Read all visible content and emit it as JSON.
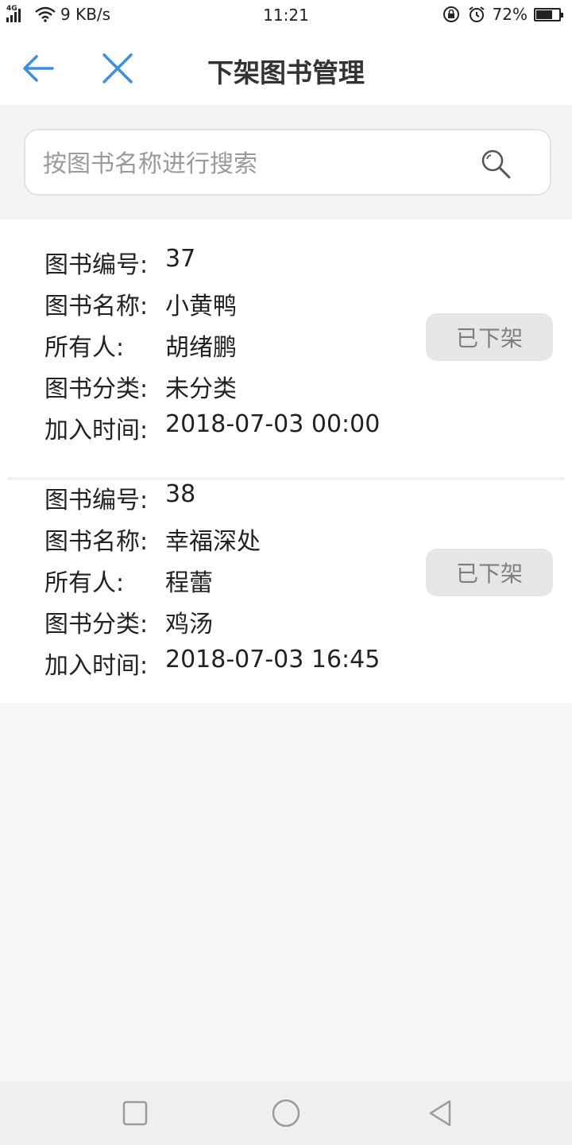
{
  "status_bar": {
    "network": "4G",
    "speed": "9 KB/s",
    "time": "11:21",
    "battery_text": "72%",
    "battery_level": 0.72
  },
  "nav": {
    "title": "下架图书管理"
  },
  "search": {
    "placeholder": "按图书名称进行搜索"
  },
  "labels": {
    "id": "图书编号:",
    "name": "图书名称:",
    "owner": "所有人:",
    "category": "图书分类:",
    "added": "加入时间:"
  },
  "books": [
    {
      "id": "37",
      "name": "小黄鸭",
      "owner": "胡绪鹏",
      "category": "未分类",
      "added": "2018-07-03 00:00",
      "status": "已下架"
    },
    {
      "id": "38",
      "name": "幸福深处",
      "owner": "程蕾",
      "category": "鸡汤",
      "added": "2018-07-03 16:45",
      "status": "已下架"
    }
  ],
  "colors": {
    "accent": "#3a8ee6",
    "background": "#f6f6f6",
    "button_bg": "#e6e6e6"
  },
  "icons": {
    "back": "arrow-left-icon",
    "close": "close-icon",
    "search": "search-icon",
    "nav_recent": "square-icon",
    "nav_home": "circle-icon",
    "nav_back": "triangle-back-icon"
  }
}
